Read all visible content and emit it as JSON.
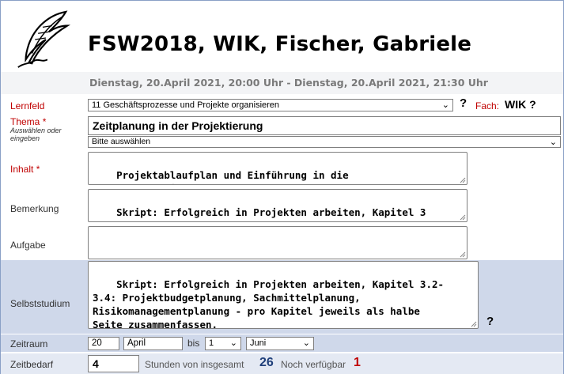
{
  "header": {
    "title": "FSW2018,  WIK, Fischer, Gabriele",
    "subtitle": "Dienstag, 20.April 2021, 20:00 Uhr - Dienstag, 20.April 2021, 21:30 Uhr"
  },
  "lernfeld": {
    "label": "Lernfeld",
    "value": "11  Geschäftsprozesse und Projekte organisieren",
    "help": "?",
    "fach_label": "Fach:",
    "fach_value": "WIK ?"
  },
  "thema": {
    "label": "Thema",
    "required": "*",
    "hint": "Auswählen oder eingeben",
    "value": "Zeitplanung in der Projektierung",
    "select_value": "Bitte auswählen"
  },
  "inhalt": {
    "label": "Inhalt",
    "required": "*",
    "value": "Projektablaufplan und Einführung in die\nNetzplantechnik"
  },
  "bemerkung": {
    "label": "Bemerkung",
    "value": "Skript: Erfolgreich in Projekten arbeiten, Kapitel 3"
  },
  "aufgabe": {
    "label": "Aufgabe",
    "value": ""
  },
  "selbststudium": {
    "label": "Selbststudium",
    "value": "Skript: Erfolgreich in Projekten arbeiten, Kapitel 3.2-\n3.4: Projektbudgetplanung, Sachmittelplanung,\nRisikomanagementplanung - pro Kapitel jeweils als halbe\nSeite zusammenfassen.",
    "help": "?"
  },
  "zeitraum": {
    "label": "Zeitraum",
    "day_from": "20",
    "month_from": "April",
    "bis": "bis",
    "day_to": "1",
    "month_to": "Juni"
  },
  "zeitbedarf": {
    "label": "Zeitbedarf",
    "value": "4",
    "stunden_text": "Stunden  von insgesamt",
    "total": "26",
    "verfuegbar_text": "Noch verfügbar",
    "verfuegbar": "1"
  },
  "colors": {
    "required_red": "#c00000",
    "row_blue": "#cfd8ea",
    "hours_blue": "#1f3f7a"
  },
  "icons": {
    "logo": "quill-feather-icon",
    "dropdown": "chevron-down-icon"
  }
}
